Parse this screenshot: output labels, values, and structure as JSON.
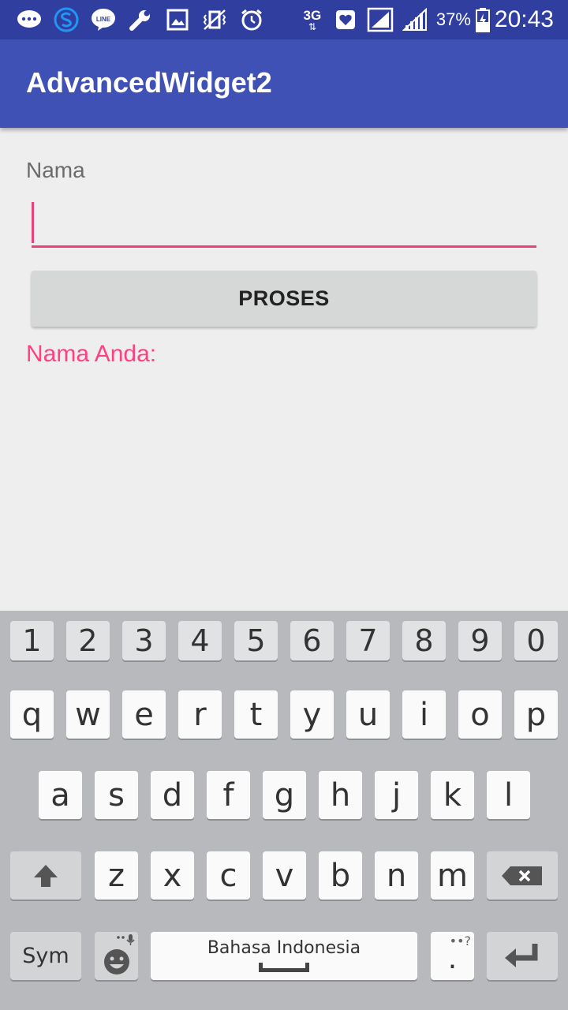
{
  "status_bar": {
    "icons": [
      "chat-icon",
      "s-icon",
      "line-icon",
      "wrench-icon",
      "image-icon",
      "vibrate-icon",
      "alarm-icon"
    ],
    "network": "3G",
    "battery_percent": "37%",
    "time": "20:43"
  },
  "app_bar": {
    "title": "AdvancedWidget2"
  },
  "form": {
    "name_label": "Nama",
    "name_value": "",
    "button_label": "PROSES",
    "result_label": "Nama Anda:"
  },
  "keyboard": {
    "row_numbers": [
      "1",
      "2",
      "3",
      "4",
      "5",
      "6",
      "7",
      "8",
      "9",
      "0"
    ],
    "row1": [
      "q",
      "w",
      "e",
      "r",
      "t",
      "y",
      "u",
      "i",
      "o",
      "p"
    ],
    "row2": [
      "a",
      "s",
      "d",
      "f",
      "g",
      "h",
      "j",
      "k",
      "l"
    ],
    "row3": [
      "z",
      "x",
      "c",
      "v",
      "b",
      "n",
      "m"
    ],
    "sym_label": "Sym",
    "space_label": "Bahasa Indonesia",
    "period_label": ".",
    "period_hint": "••?"
  },
  "colors": {
    "status_bar": "#303f9f",
    "app_bar": "#3f51b5",
    "accent": "#ff4081",
    "input_underline": "#ec407a"
  }
}
